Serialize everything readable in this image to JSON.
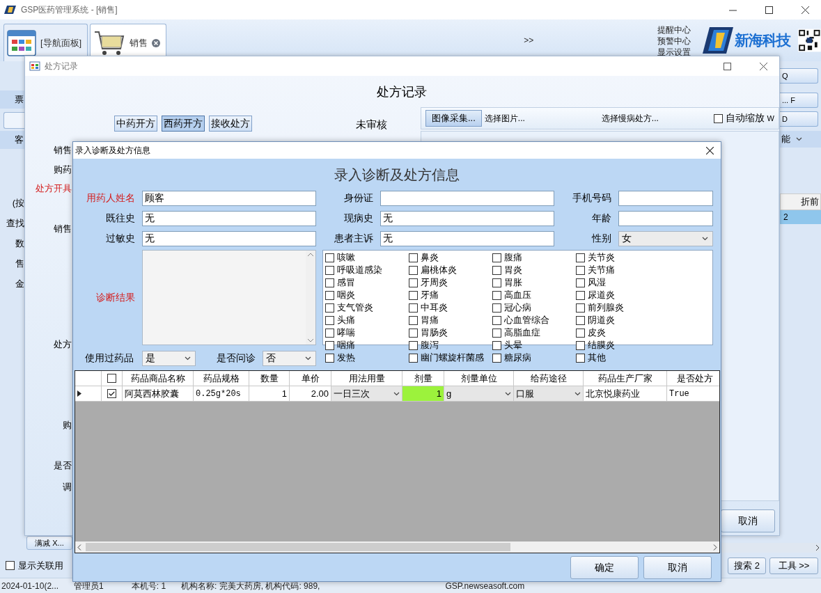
{
  "app": {
    "title": "GSP医药管理系统 - [销售]",
    "tabs": [
      {
        "label": "[导航面板]",
        "selected": false,
        "kind": "panel"
      },
      {
        "label": "销售",
        "selected": true,
        "kind": "cart"
      }
    ],
    "tab_overflow": ">>",
    "links": [
      "提醒中心",
      "预警中心",
      "显示设置"
    ],
    "brand": "新海科技",
    "side_bars": [
      "票",
      "客"
    ],
    "side_labels": [
      "(按",
      "查找",
      "数",
      "售",
      "金"
    ],
    "discount_button": "满减 X...",
    "related_checkbox": {
      "label": "显示关联用",
      "checked": false
    },
    "right_buttons": [
      "Q",
      "... F",
      "D"
    ],
    "function_menu": "能",
    "grid": {
      "header": "折前",
      "cell": "2"
    },
    "search_button": "搜索 2",
    "tools_button": "工具 >>",
    "status_bar": [
      "2024-01-10(2...",
      "管理员1",
      "本机号: 1",
      "机构名称: 完美大药房, 机构代码: 989,",
      "GSP.newseasoft.com"
    ]
  },
  "record_window": {
    "title": "处方记录",
    "heading": "处方记录",
    "mode_buttons": [
      {
        "label": "中药开方",
        "selected": false
      },
      {
        "label": "西药开方",
        "selected": true
      },
      {
        "label": "接收处方",
        "selected": false
      }
    ],
    "review_status": "未审核",
    "toolbar": {
      "capture_button": "图像采集...",
      "pick_image": "选择图片...",
      "chronic": "选择慢病处方...",
      "auto_zoom": {
        "label": "自动缩放",
        "checked": false
      },
      "shortcut": "W"
    },
    "side_labels": [
      {
        "text": "销售",
        "required": false
      },
      {
        "text": "购药",
        "required": false
      },
      {
        "text": "处方开具",
        "required": true
      },
      {
        "text": "销售",
        "required": false
      },
      {
        "text": "处方",
        "required": false
      },
      {
        "text": "购",
        "required": false
      },
      {
        "text": "是否",
        "required": false
      },
      {
        "text": "调",
        "required": false
      }
    ],
    "cancel_button": "取消"
  },
  "dialog": {
    "title": "录入诊断及处方信息",
    "heading": "录入诊断及处方信息",
    "fields": [
      {
        "label": "用药人姓名",
        "required": true,
        "kind": "text",
        "value": "顾客"
      },
      {
        "label": "身份证",
        "required": false,
        "kind": "text"
      },
      {
        "label": "手机号码",
        "required": false,
        "kind": "text"
      },
      {
        "label": "既往史",
        "required": false,
        "kind": "text",
        "value": "无"
      },
      {
        "label": "现病史",
        "required": false,
        "kind": "text",
        "value": "无"
      },
      {
        "label": "年龄",
        "required": false,
        "kind": "text"
      },
      {
        "label": "过敏史",
        "required": false,
        "kind": "text",
        "value": "无"
      },
      {
        "label": "患者主诉",
        "required": false,
        "kind": "text",
        "value": "无"
      },
      {
        "label": "性别",
        "required": false,
        "kind": "select",
        "value": "女"
      }
    ],
    "diagnosis": {
      "label": "诊断结果",
      "required": true
    },
    "symptoms": [
      {
        "label": "咳嗽",
        "checked": false
      },
      {
        "label": "呼吸道感染",
        "checked": false
      },
      {
        "label": "感冒",
        "checked": false
      },
      {
        "label": "咽炎",
        "checked": false
      },
      {
        "label": "支气管炎",
        "checked": false
      },
      {
        "label": "头痛",
        "checked": false
      },
      {
        "label": "哮喘",
        "checked": false
      },
      {
        "label": "咽痛",
        "checked": false
      },
      {
        "label": "发热",
        "checked": false
      },
      {
        "label": "鼻炎",
        "checked": false
      },
      {
        "label": "扁桃体炎",
        "checked": false
      },
      {
        "label": "牙周炎",
        "checked": false
      },
      {
        "label": "牙痛",
        "checked": false
      },
      {
        "label": "中耳炎",
        "checked": false
      },
      {
        "label": "胃痛",
        "checked": false
      },
      {
        "label": "胃肠炎",
        "checked": false
      },
      {
        "label": "腹泻",
        "checked": false
      },
      {
        "label": "幽门螺旋杆菌感",
        "checked": false
      },
      {
        "label": "腹痛",
        "checked": false
      },
      {
        "label": "胃炎",
        "checked": false
      },
      {
        "label": "胃胀",
        "checked": false
      },
      {
        "label": "高血压",
        "checked": false
      },
      {
        "label": "冠心病",
        "checked": false
      },
      {
        "label": "心血管综合",
        "checked": false
      },
      {
        "label": "高脂血症",
        "checked": false
      },
      {
        "label": "头晕",
        "checked": false
      },
      {
        "label": "糖尿病",
        "checked": false
      },
      {
        "label": "关节炎",
        "checked": false
      },
      {
        "label": "关节痛",
        "checked": false
      },
      {
        "label": "风湿",
        "checked": false
      },
      {
        "label": "尿道炎",
        "checked": false
      },
      {
        "label": "前列腺炎",
        "checked": false
      },
      {
        "label": "阴道炎",
        "checked": false
      },
      {
        "label": "皮炎",
        "checked": false
      },
      {
        "label": "结膜炎",
        "checked": false
      },
      {
        "label": "其他",
        "checked": false
      }
    ],
    "options": [
      {
        "label": "使用过药品",
        "value": "是"
      },
      {
        "label": "是否问诊",
        "value": "否"
      }
    ],
    "table": {
      "all_checked": false,
      "columns": [
        "药品商品名称",
        "药品规格",
        "数量",
        "单价",
        "用法用量",
        "剂量",
        "剂量单位",
        "给药途径",
        "药品生产厂家",
        "是否处方"
      ],
      "rows": [
        {
          "selected": true,
          "checked": true,
          "cells": [
            {
              "text": "阿莫西林胶囊",
              "kind": "text"
            },
            {
              "text": "0.25g*20s",
              "kind": "mono"
            },
            {
              "text": "1",
              "kind": "number"
            },
            {
              "text": "2.00",
              "kind": "number"
            },
            {
              "text": "一日三次",
              "kind": "dropdown"
            },
            {
              "text": "1",
              "kind": "editing"
            },
            {
              "text": "g",
              "kind": "dropdown"
            },
            {
              "text": "口服",
              "kind": "dropdown"
            },
            {
              "text": "北京悦康药业",
              "kind": "text"
            },
            {
              "text": "True",
              "kind": "mono"
            }
          ]
        }
      ]
    },
    "ok_button": "确定",
    "cancel_button": "取消"
  }
}
